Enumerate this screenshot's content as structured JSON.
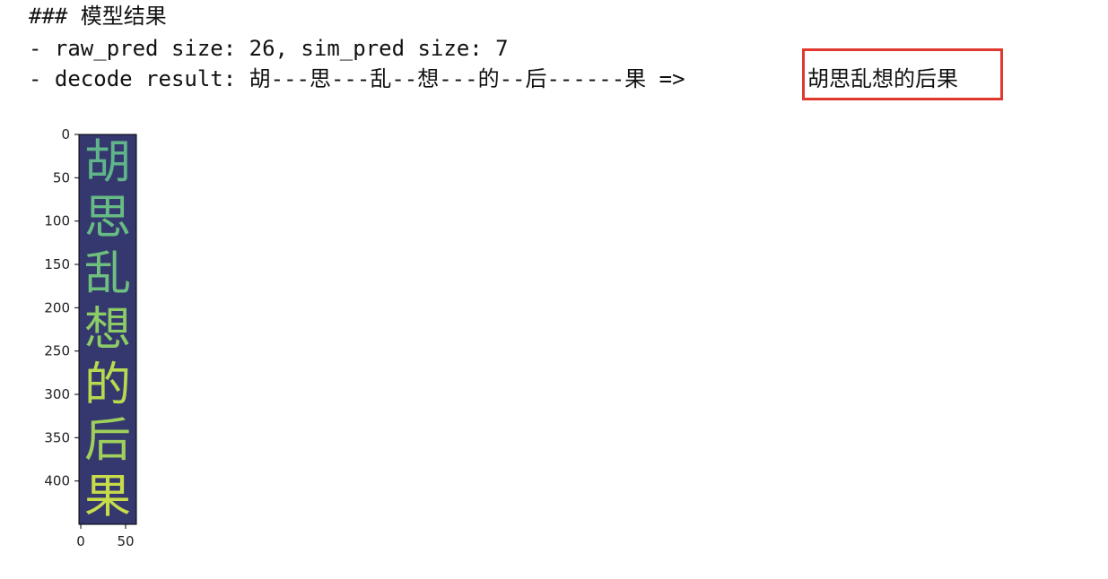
{
  "notebook_output": {
    "heading": "### 模型结果",
    "raw_line": "- raw_pred size: 26, sim_pred size: 7",
    "decode_line": "- decode result: 胡---思---乱--想---的--后------果 =>",
    "decode_result": "胡思乱想的后果"
  },
  "chart_data": {
    "type": "image",
    "image_text": [
      "胡",
      "思",
      "乱",
      "想",
      "的",
      "后",
      "果"
    ],
    "glyph_colors": [
      "#5fb48a",
      "#67bb84",
      "#6fc07e",
      "#8ccc66",
      "#b9d94e",
      "#9fd05c",
      "#c8dc4a"
    ],
    "background_color": "#35386e",
    "y_ticks": [
      0,
      50,
      100,
      150,
      200,
      250,
      300,
      350,
      400
    ],
    "x_ticks": [
      0,
      50
    ],
    "ylim": [
      450,
      0
    ],
    "xlim": [
      0,
      64
    ]
  }
}
